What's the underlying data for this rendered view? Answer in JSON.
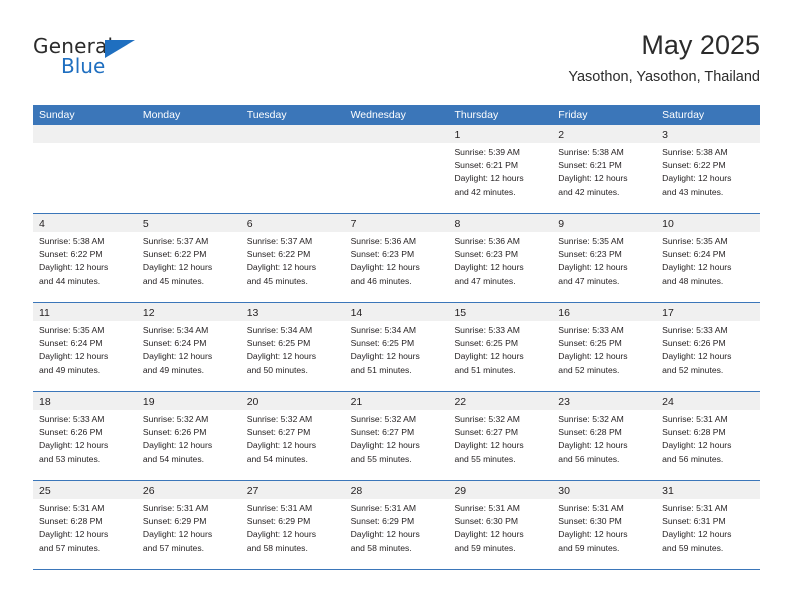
{
  "brand": {
    "name_top": "General",
    "name_bottom": "Blue",
    "accent_color": "#1f6fc0",
    "triangle_icon": "brand-triangle-icon"
  },
  "header": {
    "title": "May 2025",
    "subtitle": "Yasothon, Yasothon, Thailand"
  },
  "theme": {
    "header_bar_color": "#3b76b9",
    "day_band_color": "#f0f0f0",
    "row_separator_color": "#3b76b9",
    "text_color": "#231f20"
  },
  "weekdays": [
    "Sunday",
    "Monday",
    "Tuesday",
    "Wednesday",
    "Thursday",
    "Friday",
    "Saturday"
  ],
  "weeks": [
    [
      {
        "day": "",
        "empty": true,
        "lines": []
      },
      {
        "day": "",
        "empty": true,
        "lines": []
      },
      {
        "day": "",
        "empty": true,
        "lines": []
      },
      {
        "day": "",
        "empty": true,
        "lines": []
      },
      {
        "day": "1",
        "empty": false,
        "lines": [
          "Sunrise: 5:39 AM",
          "Sunset: 6:21 PM",
          "Daylight: 12 hours",
          "and 42 minutes."
        ]
      },
      {
        "day": "2",
        "empty": false,
        "lines": [
          "Sunrise: 5:38 AM",
          "Sunset: 6:21 PM",
          "Daylight: 12 hours",
          "and 42 minutes."
        ]
      },
      {
        "day": "3",
        "empty": false,
        "lines": [
          "Sunrise: 5:38 AM",
          "Sunset: 6:22 PM",
          "Daylight: 12 hours",
          "and 43 minutes."
        ]
      }
    ],
    [
      {
        "day": "4",
        "empty": false,
        "lines": [
          "Sunrise: 5:38 AM",
          "Sunset: 6:22 PM",
          "Daylight: 12 hours",
          "and 44 minutes."
        ]
      },
      {
        "day": "5",
        "empty": false,
        "lines": [
          "Sunrise: 5:37 AM",
          "Sunset: 6:22 PM",
          "Daylight: 12 hours",
          "and 45 minutes."
        ]
      },
      {
        "day": "6",
        "empty": false,
        "lines": [
          "Sunrise: 5:37 AM",
          "Sunset: 6:22 PM",
          "Daylight: 12 hours",
          "and 45 minutes."
        ]
      },
      {
        "day": "7",
        "empty": false,
        "lines": [
          "Sunrise: 5:36 AM",
          "Sunset: 6:23 PM",
          "Daylight: 12 hours",
          "and 46 minutes."
        ]
      },
      {
        "day": "8",
        "empty": false,
        "lines": [
          "Sunrise: 5:36 AM",
          "Sunset: 6:23 PM",
          "Daylight: 12 hours",
          "and 47 minutes."
        ]
      },
      {
        "day": "9",
        "empty": false,
        "lines": [
          "Sunrise: 5:35 AM",
          "Sunset: 6:23 PM",
          "Daylight: 12 hours",
          "and 47 minutes."
        ]
      },
      {
        "day": "10",
        "empty": false,
        "lines": [
          "Sunrise: 5:35 AM",
          "Sunset: 6:24 PM",
          "Daylight: 12 hours",
          "and 48 minutes."
        ]
      }
    ],
    [
      {
        "day": "11",
        "empty": false,
        "lines": [
          "Sunrise: 5:35 AM",
          "Sunset: 6:24 PM",
          "Daylight: 12 hours",
          "and 49 minutes."
        ]
      },
      {
        "day": "12",
        "empty": false,
        "lines": [
          "Sunrise: 5:34 AM",
          "Sunset: 6:24 PM",
          "Daylight: 12 hours",
          "and 49 minutes."
        ]
      },
      {
        "day": "13",
        "empty": false,
        "lines": [
          "Sunrise: 5:34 AM",
          "Sunset: 6:25 PM",
          "Daylight: 12 hours",
          "and 50 minutes."
        ]
      },
      {
        "day": "14",
        "empty": false,
        "lines": [
          "Sunrise: 5:34 AM",
          "Sunset: 6:25 PM",
          "Daylight: 12 hours",
          "and 51 minutes."
        ]
      },
      {
        "day": "15",
        "empty": false,
        "lines": [
          "Sunrise: 5:33 AM",
          "Sunset: 6:25 PM",
          "Daylight: 12 hours",
          "and 51 minutes."
        ]
      },
      {
        "day": "16",
        "empty": false,
        "lines": [
          "Sunrise: 5:33 AM",
          "Sunset: 6:25 PM",
          "Daylight: 12 hours",
          "and 52 minutes."
        ]
      },
      {
        "day": "17",
        "empty": false,
        "lines": [
          "Sunrise: 5:33 AM",
          "Sunset: 6:26 PM",
          "Daylight: 12 hours",
          "and 52 minutes."
        ]
      }
    ],
    [
      {
        "day": "18",
        "empty": false,
        "lines": [
          "Sunrise: 5:33 AM",
          "Sunset: 6:26 PM",
          "Daylight: 12 hours",
          "and 53 minutes."
        ]
      },
      {
        "day": "19",
        "empty": false,
        "lines": [
          "Sunrise: 5:32 AM",
          "Sunset: 6:26 PM",
          "Daylight: 12 hours",
          "and 54 minutes."
        ]
      },
      {
        "day": "20",
        "empty": false,
        "lines": [
          "Sunrise: 5:32 AM",
          "Sunset: 6:27 PM",
          "Daylight: 12 hours",
          "and 54 minutes."
        ]
      },
      {
        "day": "21",
        "empty": false,
        "lines": [
          "Sunrise: 5:32 AM",
          "Sunset: 6:27 PM",
          "Daylight: 12 hours",
          "and 55 minutes."
        ]
      },
      {
        "day": "22",
        "empty": false,
        "lines": [
          "Sunrise: 5:32 AM",
          "Sunset: 6:27 PM",
          "Daylight: 12 hours",
          "and 55 minutes."
        ]
      },
      {
        "day": "23",
        "empty": false,
        "lines": [
          "Sunrise: 5:32 AM",
          "Sunset: 6:28 PM",
          "Daylight: 12 hours",
          "and 56 minutes."
        ]
      },
      {
        "day": "24",
        "empty": false,
        "lines": [
          "Sunrise: 5:31 AM",
          "Sunset: 6:28 PM",
          "Daylight: 12 hours",
          "and 56 minutes."
        ]
      }
    ],
    [
      {
        "day": "25",
        "empty": false,
        "lines": [
          "Sunrise: 5:31 AM",
          "Sunset: 6:28 PM",
          "Daylight: 12 hours",
          "and 57 minutes."
        ]
      },
      {
        "day": "26",
        "empty": false,
        "lines": [
          "Sunrise: 5:31 AM",
          "Sunset: 6:29 PM",
          "Daylight: 12 hours",
          "and 57 minutes."
        ]
      },
      {
        "day": "27",
        "empty": false,
        "lines": [
          "Sunrise: 5:31 AM",
          "Sunset: 6:29 PM",
          "Daylight: 12 hours",
          "and 58 minutes."
        ]
      },
      {
        "day": "28",
        "empty": false,
        "lines": [
          "Sunrise: 5:31 AM",
          "Sunset: 6:29 PM",
          "Daylight: 12 hours",
          "and 58 minutes."
        ]
      },
      {
        "day": "29",
        "empty": false,
        "lines": [
          "Sunrise: 5:31 AM",
          "Sunset: 6:30 PM",
          "Daylight: 12 hours",
          "and 59 minutes."
        ]
      },
      {
        "day": "30",
        "empty": false,
        "lines": [
          "Sunrise: 5:31 AM",
          "Sunset: 6:30 PM",
          "Daylight: 12 hours",
          "and 59 minutes."
        ]
      },
      {
        "day": "31",
        "empty": false,
        "lines": [
          "Sunrise: 5:31 AM",
          "Sunset: 6:31 PM",
          "Daylight: 12 hours",
          "and 59 minutes."
        ]
      }
    ]
  ]
}
